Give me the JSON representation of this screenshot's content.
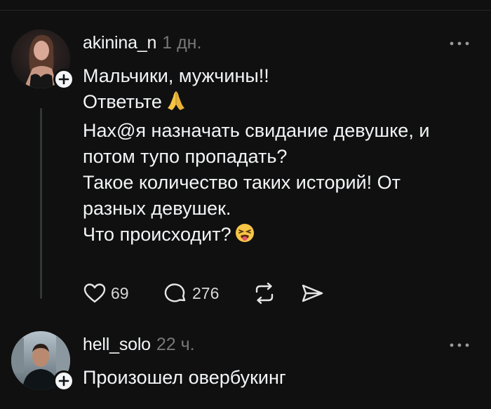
{
  "posts": [
    {
      "username": "akinina_n",
      "timestamp": "1 дн.",
      "lines": [
        "Мальчики, мужчины!!",
        "Ответьте",
        "Нах@я назначать свидание девушке, и",
        "потом тупо пропадать?",
        "Такое количество таких историй! От",
        "разных девушек.",
        "Что происходит?"
      ],
      "emoji": [
        "folded-hands",
        "tired-face"
      ],
      "likes": "69",
      "replies": "276"
    },
    {
      "username": "hell_solo",
      "timestamp": "22 ч.",
      "lines": [
        "Произошел овербукинг"
      ]
    }
  ],
  "colors": {
    "background": "#101010",
    "text": "#f3f5f7",
    "muted": "#777777",
    "thread_line": "#333638"
  },
  "icons": [
    "plus-icon",
    "more-icon",
    "heart-icon",
    "comment-icon",
    "repost-icon",
    "share-icon"
  ]
}
